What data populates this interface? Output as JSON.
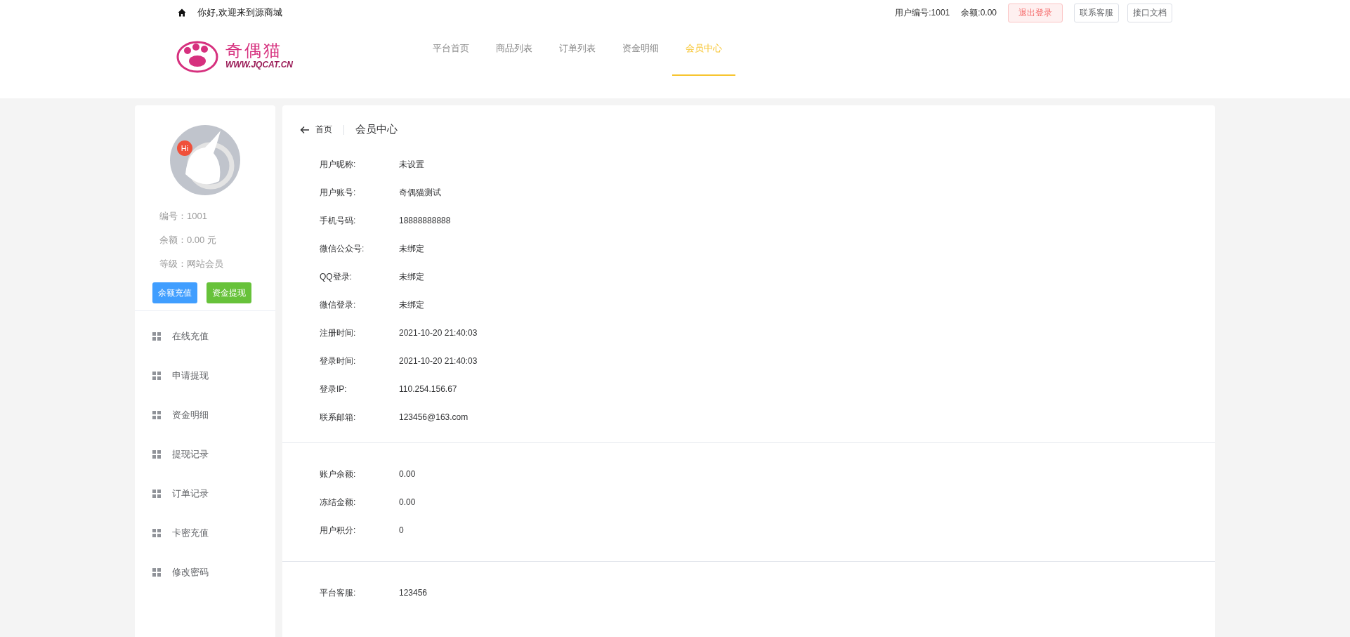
{
  "top_bar": {
    "greeting": "你好,欢迎来到源商城",
    "user_id": "用户编号:1001",
    "balance": "余额:0.00",
    "buttons": [
      {
        "label": "退出登录",
        "kind": "danger"
      },
      {
        "label": "联系客服",
        "kind": "plain"
      },
      {
        "label": "接口文档",
        "kind": "plain"
      }
    ]
  },
  "logo": {
    "name": "奇偶猫",
    "url": "WWW.JQCAT.CN"
  },
  "nav": [
    {
      "label": "平台首页",
      "selected": false
    },
    {
      "label": "商品列表",
      "selected": false
    },
    {
      "label": "订单列表",
      "selected": false
    },
    {
      "label": "资金明细",
      "selected": false
    },
    {
      "label": "会员中心",
      "selected": true
    }
  ],
  "sidebar": {
    "avatar_badge": "Hi",
    "info": [
      "编号：1001",
      "余额：0.00 元",
      "等级：网站会员"
    ],
    "buttons": [
      {
        "label": "余额充值",
        "kind": "primary"
      },
      {
        "label": "资金提现",
        "kind": "success"
      }
    ],
    "items": [
      "在线充值",
      "申请提现",
      "资金明细",
      "提现记录",
      "订单记录",
      "卡密充值",
      "修改密码"
    ]
  },
  "content": {
    "back": "首页",
    "title": "会员中心",
    "sections": [
      [
        {
          "label": "用户昵称:",
          "value": "未设置"
        },
        {
          "label": "用户账号:",
          "value": "奇偶猫测试"
        },
        {
          "label": "手机号码:",
          "value": "18888888888"
        },
        {
          "label": "微信公众号:",
          "value": "未绑定"
        },
        {
          "label": "QQ登录:",
          "value": "未绑定"
        },
        {
          "label": "微信登录:",
          "value": "未绑定"
        },
        {
          "label": "注册时间:",
          "value": "2021-10-20 21:40:03"
        },
        {
          "label": "登录时间:",
          "value": "2021-10-20 21:40:03"
        },
        {
          "label": "登录IP:",
          "value": "110.254.156.67"
        },
        {
          "label": "联系邮箱:",
          "value": "123456@163.com"
        }
      ],
      [
        {
          "label": "账户余额:",
          "value": "0.00"
        },
        {
          "label": "冻结金额:",
          "value": "0.00"
        },
        {
          "label": "用户积分:",
          "value": "0"
        }
      ],
      [
        {
          "label": "平台客服:",
          "value": "123456"
        }
      ]
    ]
  }
}
